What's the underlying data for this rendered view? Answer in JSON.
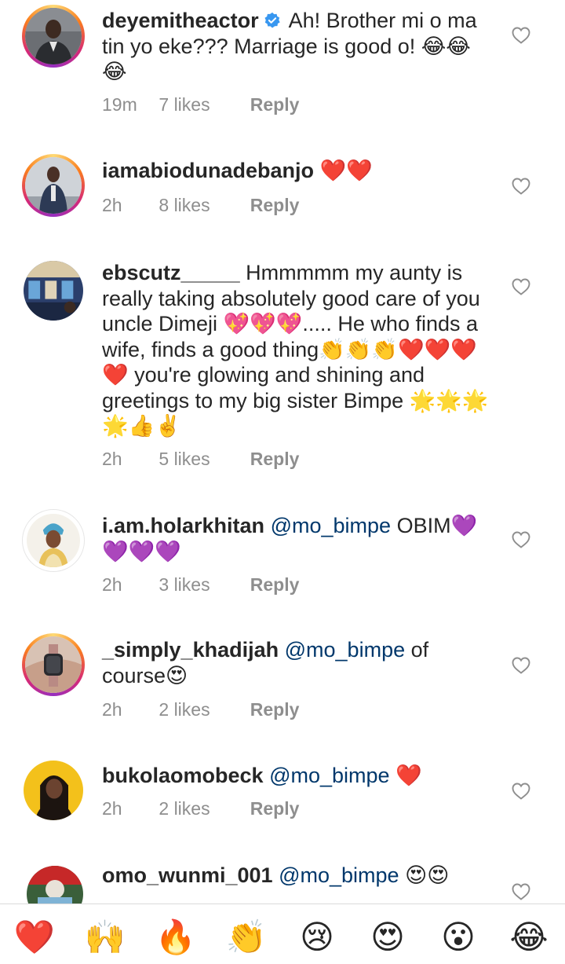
{
  "comments": [
    {
      "username": "deyemitheactor",
      "verified": true,
      "text": "Ah! Brother mi o ma tin yo eke??? Marriage is good o! 😂😂😂",
      "time": "19m",
      "likes": "7 likes",
      "reply": "Reply",
      "avatar": "man-in-suit"
    },
    {
      "username": "iamabiodunadebanjo",
      "text": "❤️❤️",
      "time": "2h",
      "likes": "8 likes",
      "reply": "Reply",
      "avatar": "man-standing"
    },
    {
      "username": "ebscutz_____",
      "text": "Hmmmmm my aunty is really taking absolutely good care of you uncle Dimeji 💖💖💖..... He who finds a wife, finds a good thing👏👏👏❤️❤️❤️❤️ you're glowing and shining and greetings to my big sister Bimpe 🌟🌟🌟🌟👍✌️",
      "time": "2h",
      "likes": "5 likes",
      "reply": "Reply",
      "avatar": "salon-interior"
    },
    {
      "username": "i.am.holarkhitan",
      "mention": "@mo_bimpe",
      "text": "OBIM💜💜💜💜",
      "time": "2h",
      "likes": "3 likes",
      "reply": "Reply",
      "avatar": "woman-headwrap"
    },
    {
      "username": "_simply_khadijah",
      "mention": "@mo_bimpe",
      "text": "of course😍",
      "time": "2h",
      "likes": "2 likes",
      "reply": "Reply",
      "avatar": "smartwatch"
    },
    {
      "username": "bukolaomobeck",
      "mention": "@mo_bimpe",
      "text": "❤️",
      "time": "2h",
      "likes": "2 likes",
      "reply": "Reply",
      "avatar": "woman-yellow-bg"
    },
    {
      "username": "omo_wunmi_001",
      "mention": "@mo_bimpe",
      "text": "😍😍",
      "avatar": "colorful-photo"
    }
  ],
  "reactions": [
    "❤️",
    "🙌",
    "🔥",
    "👏",
    "😢",
    "😍",
    "😮",
    "😂"
  ],
  "colors": {
    "username": "#262626",
    "mention": "#00376b",
    "meta": "#8e8e8e",
    "story_ring": [
      "#feda75",
      "#fa7e1e",
      "#d62976",
      "#962fbf"
    ]
  }
}
